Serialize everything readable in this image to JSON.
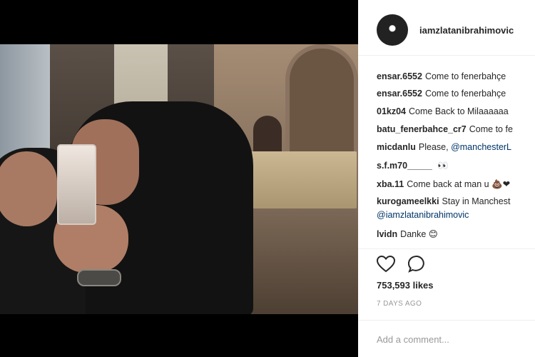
{
  "post": {
    "username": "iamzlatanibrahimovic",
    "avatar_icon": "avatar-icon",
    "likes": "753,593 likes",
    "timestamp": "7 DAYS AGO",
    "add_comment_placeholder": "Add a comment..."
  },
  "comments": [
    {
      "user": "ensar.6552",
      "text": "Come to fenerbahçe"
    },
    {
      "user": "ensar.6552",
      "text": "Come to fenerbahçe"
    },
    {
      "user": "01kz04",
      "text": "Come Back to Milaaaaaa"
    },
    {
      "user": "batu_fenerbahce_cr7",
      "text": "Come to fe"
    },
    {
      "user": "micdanlu",
      "text": "Please,",
      "mention": "@manchesterL"
    },
    {
      "user": "s.f.m70_____",
      "text": "",
      "emoji": "👀"
    },
    {
      "user": "xba.11",
      "text": "Come back at man u",
      "emoji": "💩❤"
    },
    {
      "user": "kurogameelkki",
      "text": "Stay in Manchest",
      "mention_line": "@iamzlatanibrahimovic"
    },
    {
      "user": "lvidn",
      "text": "Danke",
      "emoji": "😊"
    }
  ],
  "colors": {
    "mention": "#003569",
    "muted": "#999999",
    "text": "#262626"
  }
}
